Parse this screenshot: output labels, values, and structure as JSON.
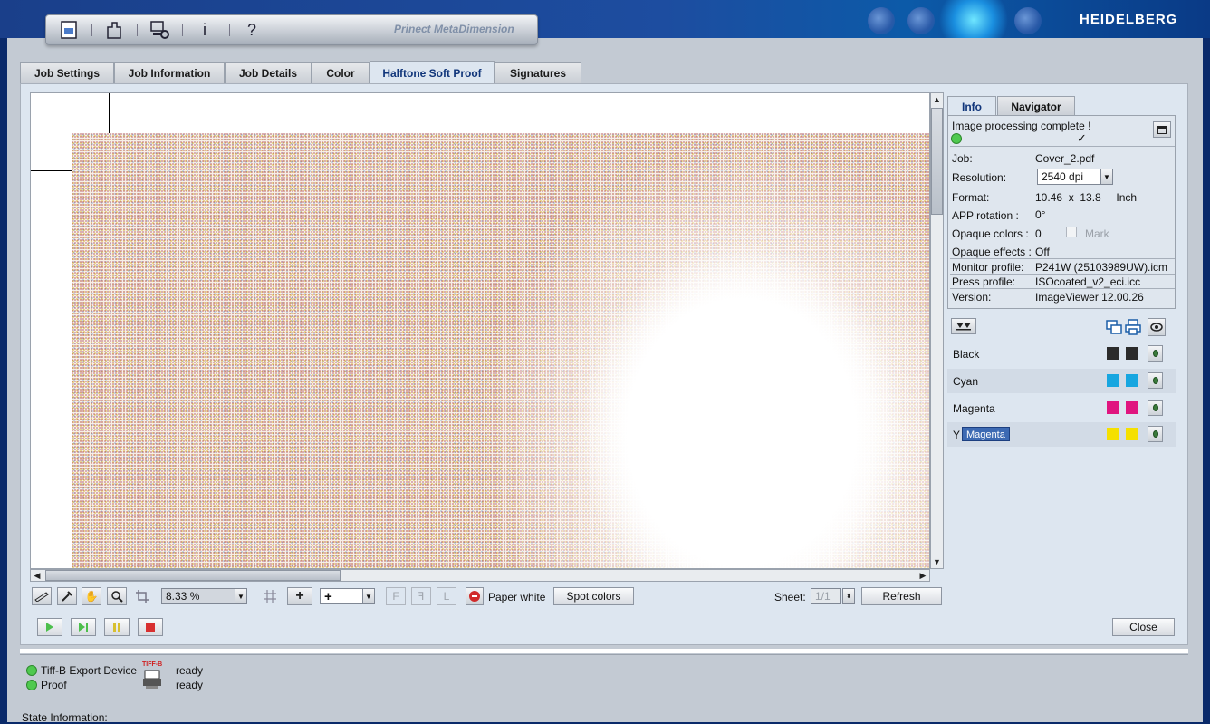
{
  "brand": {
    "name": "HEIDELBERG"
  },
  "toolbar": {
    "title": "Prinect MetaDimension",
    "icons": [
      "job-icon",
      "devices-icon",
      "settings-computer-icon",
      "info-icon",
      "help-icon"
    ],
    "info_glyph": "i",
    "help_glyph": "?"
  },
  "tabs": [
    {
      "label": "Job Settings"
    },
    {
      "label": "Job Information"
    },
    {
      "label": "Job Details"
    },
    {
      "label": "Color"
    },
    {
      "label": "Halftone Soft Proof",
      "active": true
    },
    {
      "label": "Signatures"
    }
  ],
  "viewer_controls": {
    "zoom": "8.33 %",
    "add_glyph": "+",
    "add_combo": "+",
    "paper_white_label": "Paper white",
    "spot_colors_label": "Spot colors",
    "sheet_label": "Sheet:",
    "sheet_value": "1/1",
    "refresh_label": "Refresh"
  },
  "right_panel": {
    "tabs": [
      {
        "label": "Info",
        "active": true
      },
      {
        "label": "Navigator"
      }
    ],
    "status_text": "Image processing complete !",
    "status_check": "✓",
    "rows": [
      {
        "label": "Job:",
        "value": "Cover_2.pdf"
      },
      {
        "label": "Resolution:",
        "value": "2540 dpi"
      },
      {
        "label": "Format:",
        "value": "10.46  x  13.8     Inch"
      },
      {
        "label": "APP rotation :",
        "value": "0°"
      },
      {
        "label": "Opaque colors :",
        "value": "0"
      },
      {
        "label": "Opaque effects :",
        "value": "Off"
      },
      {
        "label": "Monitor profile:",
        "value": "P241W (25103989UW).icm"
      },
      {
        "label": "Press profile:",
        "value": "ISOcoated_v2_eci.icc"
      },
      {
        "label": "Version:",
        "value": "ImageViewer 12.00.26"
      }
    ],
    "mark_label": "Mark",
    "separations": [
      {
        "name": "Black",
        "color": "#2b2b2b"
      },
      {
        "name": "Cyan",
        "color": "#17a6e0"
      },
      {
        "name": "Magenta",
        "color": "#e0157f"
      },
      {
        "name": "Yellow",
        "color": "#f5e000",
        "visible_text": "Y"
      }
    ],
    "tooltip": "Magenta"
  },
  "actions": {
    "close_label": "Close"
  },
  "status": {
    "devices": [
      {
        "name": "Tiff-B Export Device",
        "state": "ready"
      },
      {
        "name": "Proof",
        "state": "ready"
      }
    ],
    "device_badge": "TIFF-B",
    "state_information_label": "State Information:"
  },
  "colors": {
    "accent_tab_text": "#10357a",
    "panel_bg": "#dde6f0",
    "status_green": "#4fc94f"
  }
}
